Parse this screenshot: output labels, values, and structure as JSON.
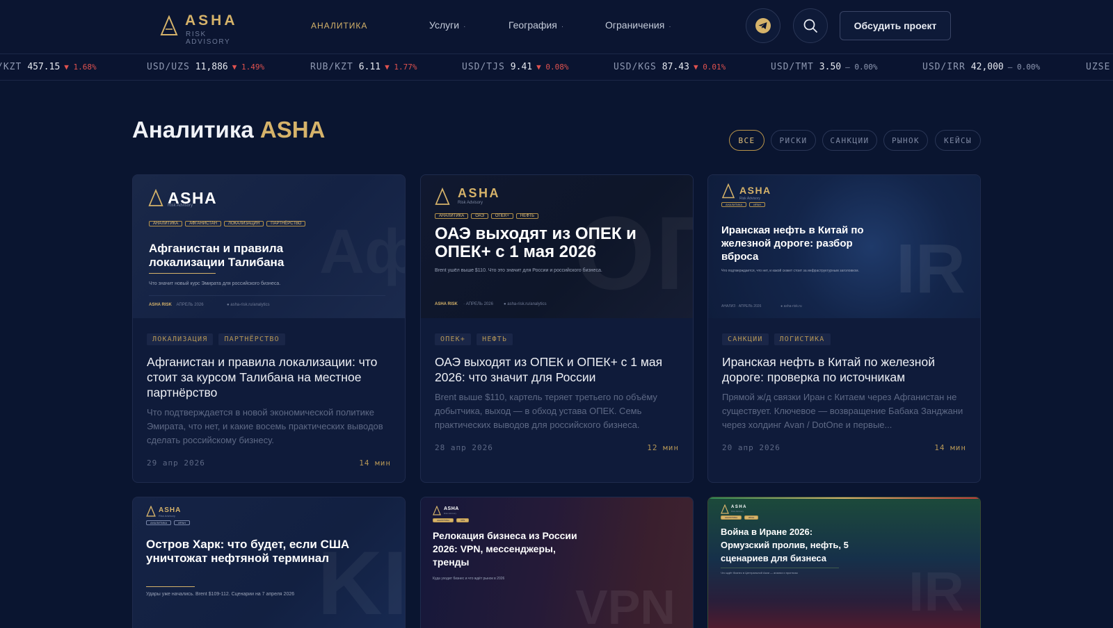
{
  "header": {
    "logo_word": "ASHA",
    "logo_sub": "Risk Advisory",
    "nav": [
      {
        "label": "АНАЛИТИКА",
        "active": true,
        "has_dropdown": false
      },
      {
        "label": "Услуги",
        "active": false,
        "has_dropdown": true
      },
      {
        "label": "География",
        "active": false,
        "has_dropdown": true
      },
      {
        "label": "Ограничения",
        "active": false,
        "has_dropdown": true
      }
    ],
    "caret": "·",
    "icons": [
      "telegram-icon",
      "search-icon"
    ],
    "cta_label": "Обсудить проект"
  },
  "ticker": [
    {
      "pair": "/KZT",
      "price": "457.15",
      "arrow": "▼",
      "change": "1.68%",
      "dir": "down"
    },
    {
      "pair": "USD/UZS",
      "price": "11,886",
      "arrow": "▼",
      "change": "1.49%",
      "dir": "down"
    },
    {
      "pair": "RUB/KZT",
      "price": "6.11",
      "arrow": "▼",
      "change": "1.77%",
      "dir": "down"
    },
    {
      "pair": "USD/TJS",
      "price": "9.41",
      "arrow": "▼",
      "change": "0.08%",
      "dir": "down"
    },
    {
      "pair": "USD/KGS",
      "price": "87.43",
      "arrow": "▼",
      "change": "0.01%",
      "dir": "down"
    },
    {
      "pair": "USD/TMT",
      "price": "3.50",
      "arrow": "—",
      "change": "0.00%",
      "dir": "flat"
    },
    {
      "pair": "USD/IRR",
      "price": "42,000",
      "arrow": "—",
      "change": "0.00%",
      "dir": "flat"
    },
    {
      "pair": "UZSE",
      "price": "",
      "arrow": "",
      "change": "",
      "dir": "flat"
    }
  ],
  "section": {
    "title": "Аналитика",
    "title_accent": "ASHA",
    "filters": [
      {
        "label": "ВСЕ",
        "active": true
      },
      {
        "label": "РИСКИ",
        "active": false
      },
      {
        "label": "САНКЦИИ",
        "active": false
      },
      {
        "label": "РЫНОК",
        "active": false
      },
      {
        "label": "КЕЙСЫ",
        "active": false
      }
    ]
  },
  "cards": [
    {
      "cover": {
        "logo_word": "ASHA",
        "logo_sub": "Risk Advisory",
        "tags": [
          "АНАЛИТИКА",
          "АФГАНИСТАН",
          "ЛОКАЛИЗАЦИЯ",
          "ПАРТНЁРСТВО"
        ],
        "title": "Афганистан и правила локализации Талибана",
        "sub": "Что значит новый курс Эмирата для российского бизнеса.",
        "foot_brand": "ASHA RISK",
        "foot_date": "АПРЕЛЬ 2026",
        "foot_url": "● asha-risk.ru/analytics",
        "big": "Аф"
      },
      "tags": [
        "ЛОКАЛИЗАЦИЯ",
        "ПАРТНЁРСТВО"
      ],
      "title": "Афганистан и правила локализации: что стоит за курсом Талибана на местное партнёрство",
      "excerpt": "Что подтверждается в новой экономической политике Эмирата, что нет, и какие восемь практических выводов сделать российскому бизнесу.",
      "date": "29 апр 2026",
      "read": "14 мин"
    },
    {
      "cover": {
        "logo_word": "ASHA",
        "logo_sub": "Risk Advisory",
        "tags": [
          "АНАЛИТИКА",
          "ОАЭ",
          "ОПЕК+",
          "НЕФТЬ"
        ],
        "title": "ОАЭ выходят из ОПЕК и ОПЕК+ с 1 мая 2026",
        "sub": "Brent ушёл выше $110. Что это значит для России и российского бизнеса.",
        "foot_brand": "ASHA RISK",
        "foot_date": "· АПРЕЛЬ 2026",
        "foot_url": "● asha-risk.ru/analytics",
        "big": "OП"
      },
      "tags": [
        "ОПЕК+",
        "НЕФТЬ"
      ],
      "title": "ОАЭ выходят из ОПЕК и ОПЕК+ с 1 мая 2026: что значит для России",
      "excerpt": "Brent выше $110, картель теряет третьего по объёму добытчика, выход — в обход устава ОПЕК. Семь практических выводов для российского бизнеса.",
      "date": "28 апр 2026",
      "read": "12 мин"
    },
    {
      "cover": {
        "logo_word": "ASHA",
        "logo_sub": "Risk Advisory",
        "tags": [
          "АНАЛИТИКА",
          "ИРАН"
        ],
        "title": "Иранская нефть в Китай по железной дороге: разбор вброса",
        "sub": "Что подтверждается, что нет, и какой сюжет стоит за инфраструктурным заголовком.",
        "foot_brand": "",
        "foot_date": "АНАЛИЗ · АПРЕЛЬ 2026",
        "foot_url": "● asha-risk.ru",
        "big": "IR"
      },
      "tags": [
        "САНКЦИИ",
        "ЛОГИСТИКА"
      ],
      "title": "Иранская нефть в Китай по железной дороге: проверка по источникам",
      "excerpt": "Прямой ж/д связки Иран с Китаем через Афганистан не существует. Ключевое — возвращение Бабака Занджани через холдинг Avan / DotOne и первые...",
      "date": "20 апр 2026",
      "read": "14 мин"
    },
    {
      "cover": {
        "logo_word": "ASHA",
        "logo_sub": "Risk Advisory",
        "tags": [
          "АНАЛИТИКА",
          "ИРАН"
        ],
        "title": "Остров Харк: что будет, если США уничтожат нефтяной терминал",
        "sub": "Удары уже начались. Brent $109-112. Сценарии на 7 апреля 2026",
        "big": "KI"
      }
    },
    {
      "cover": {
        "logo_word": "ASHA",
        "logo_sub": "Risk Advisory",
        "tags": [
          "АНАЛИТИКА",
          "VPN"
        ],
        "title": "Релокация бизнеса из России 2026: VPN, мессенджеры, тренды",
        "sub": "Куда уходит бизнес и что ждёт рынок в 2026",
        "big": "VPN"
      }
    },
    {
      "cover": {
        "logo_word": "ASHA",
        "logo_sub": "Risk Advisory",
        "tags": [
          "АНАЛИТИКА",
          "ИРАН"
        ],
        "title": "Война в Иране 2026: Ормузский пролив, нефть, 5 сценариев для бизнеса",
        "sub": "Что ждёт бизнес в Центральной Азии — анализ и прогнозы",
        "big": "IR"
      }
    }
  ]
}
